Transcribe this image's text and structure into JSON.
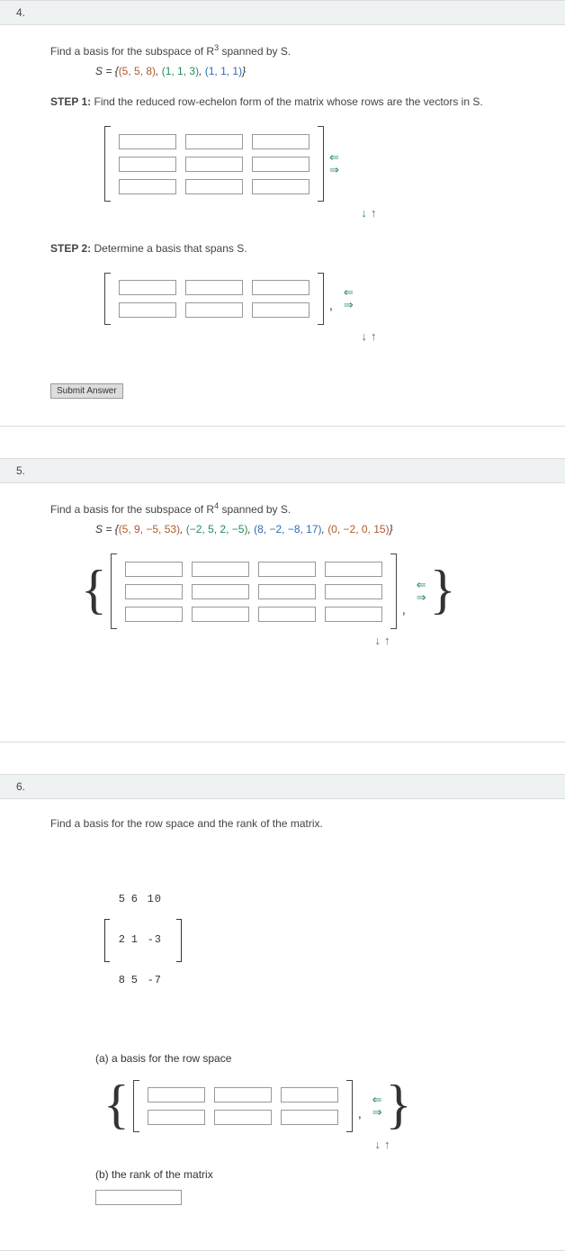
{
  "q4": {
    "number": "4.",
    "instruct": "Find a basis for the subspace of R",
    "exp": "3",
    "instruct2": " spanned by S.",
    "setline_pre": "S = {",
    "v1": "(5, 5, 8)",
    "c": ", ",
    "v2": "(1, 1, 3)",
    "v3": "(1, 1, 1)",
    "setline_post": "}",
    "step1": "STEP 1:",
    "step1txt": "Find the reduced row-echelon form of the matrix whose rows are the vectors in S.",
    "step2": "STEP 2:",
    "step2txt": "Determine a basis that spans S.",
    "submit": "Submit Answer"
  },
  "q5": {
    "number": "5.",
    "instruct": "Find a basis for the subspace of R",
    "exp": "4",
    "instruct2": " spanned by S.",
    "setline_pre": "S = {",
    "v1": "(5, 9, −5, 53)",
    "c": ", ",
    "v2": "(−2, 5, 2, −5)",
    "v3": "(8, −2, −8, 17)",
    "v4": "(0, −2, 0, 15)",
    "setline_post": "}"
  },
  "q6": {
    "number": "6.",
    "instruct": "Find a basis for the row space and the rank of the matrix.",
    "parta": "(a) a basis for the row space",
    "partb": "(b) the rank of the matrix",
    "m": {
      "r1c1": "5",
      "r1c2": "6",
      "r1c3": "10",
      "r2c1": "2",
      "r2c2": "1",
      "r2c3": "-3",
      "r3c1": "8",
      "r3c2": "5",
      "r3c3": "-7"
    }
  },
  "arrows": {
    "left": "⇐",
    "right": "⇒",
    "down": "↓",
    "up": "↑"
  }
}
